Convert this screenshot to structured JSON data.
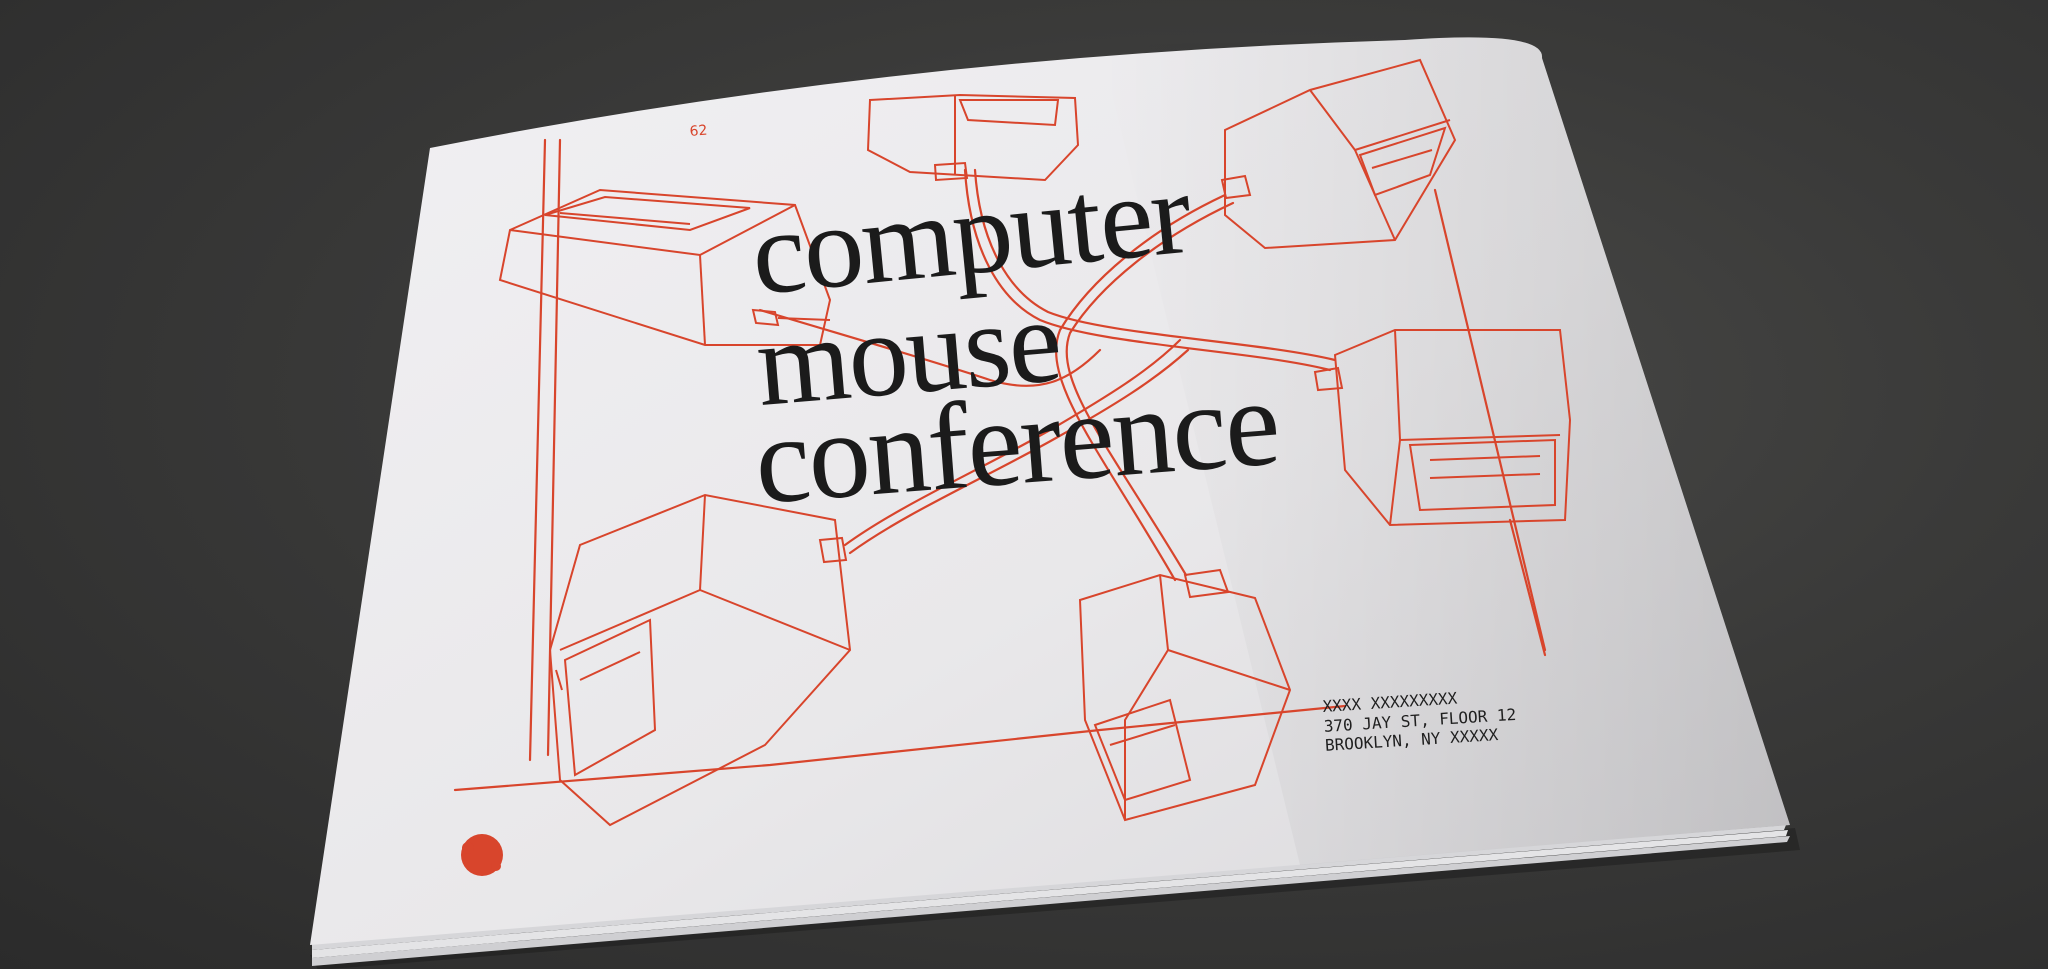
{
  "booklet": {
    "title_lines": [
      "computer",
      "mouse",
      "conference"
    ],
    "address_lines": [
      "XXXX XXXXXXXXX",
      "370 JAY ST, FLOOR 12",
      "BROOKLYN, NY XXXXX"
    ],
    "page_number": "62"
  },
  "colors": {
    "table": "#353534",
    "paper": "#e9e8ea",
    "ink_red": "#d8452c",
    "ink_black": "#1b1b1b"
  }
}
